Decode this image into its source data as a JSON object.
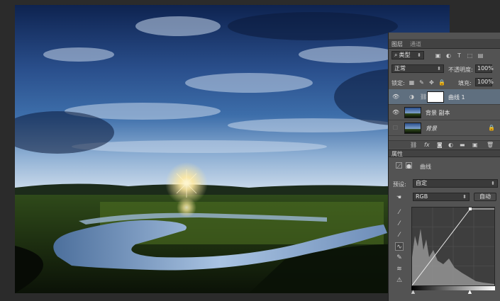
{
  "layers_panel": {
    "tabs": [
      "图层",
      "通道"
    ],
    "filter_kind": "类型",
    "blend_mode": "正常",
    "opacity_label": "不透明度:",
    "opacity_value": "100%",
    "lock_label": "锁定:",
    "fill_label": "填充:",
    "fill_value": "100%",
    "layers": [
      {
        "name": "曲线 1",
        "selected": true,
        "kind": "adjustment"
      },
      {
        "name": "背景 副本",
        "selected": false,
        "kind": "image"
      },
      {
        "name": "背景",
        "selected": false,
        "kind": "image",
        "locked": true
      }
    ]
  },
  "properties_panel": {
    "title": "属性",
    "adjustment_name": "曲线",
    "preset_label": "预设:",
    "preset_value": "自定",
    "channel_value": "RGB",
    "auto_button": "自动"
  },
  "colors": {
    "panel_bg": "#535353",
    "selected_layer": "#5f6f7f",
    "sky": "#1c3a6e",
    "grass": "#3f5a1f"
  }
}
